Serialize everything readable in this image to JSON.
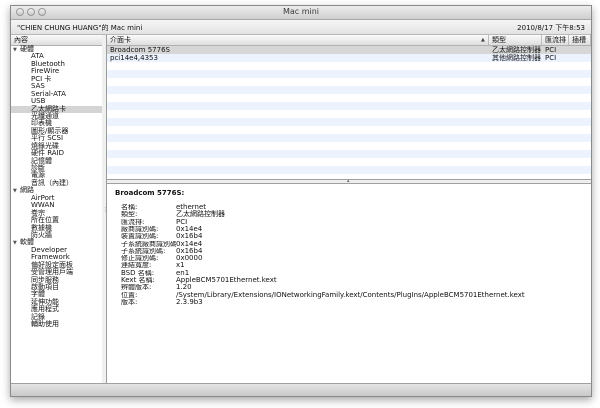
{
  "window": {
    "title": "Mac mini",
    "machine_name": "\"CHIEN CHUNG HUANG\"的 Mac mini",
    "datetime": "2010/8/17 下午8:53"
  },
  "sidebar": {
    "header": "內容",
    "categories": [
      {
        "label": "硬體",
        "items": [
          "ATA",
          "Bluetooth",
          "FireWire",
          "PCI 卡",
          "SAS",
          "Serial-ATA",
          "USB",
          "乙太網路卡",
          "光纖通道",
          "印表機",
          "圖形/顯示器",
          "平行 SCSI",
          "燒錄光碟",
          "硬件 RAID",
          "記憶體",
          "診斷",
          "電源",
          "音訊（內建）"
        ]
      },
      {
        "label": "網路",
        "items": [
          "AirPort",
          "WWAN",
          "卷宗",
          "所在位置",
          "數據機",
          "防火牆"
        ]
      },
      {
        "label": "軟體",
        "items": [
          "Developer",
          "Framework",
          "偏好設定面板",
          "受管理用戶端",
          "同步服務",
          "啟動項目",
          "字體",
          "延伸功能",
          "應用程式",
          "記錄",
          "輔助使用"
        ]
      }
    ],
    "selected": "乙太網路卡"
  },
  "table": {
    "columns": [
      "介面卡",
      "類型",
      "匯流排",
      "插槽"
    ],
    "rows": [
      {
        "name": "Broadcom 5776S",
        "type": "乙太網路控制器",
        "bus": "PCI",
        "slot": ""
      },
      {
        "name": "pci14e4,4353",
        "type": "其他網路控制器",
        "bus": "PCI",
        "slot": ""
      }
    ]
  },
  "detail": {
    "title": "Broadcom 5776S:",
    "fields": [
      {
        "key": "名稱:",
        "value": "ethernet"
      },
      {
        "key": "類型:",
        "value": "乙太網路控制器"
      },
      {
        "key": "匯流排:",
        "value": "PCI"
      },
      {
        "key": "廠商識別碼:",
        "value": "0x14e4"
      },
      {
        "key": "裝置識別碼:",
        "value": "0x16b4"
      },
      {
        "key": "子系統廠商識別碼:",
        "value": "0x14e4"
      },
      {
        "key": "子系統識別碼:",
        "value": "0x16b4"
      },
      {
        "key": "修正識別碼:",
        "value": "0x0000"
      },
      {
        "key": "連結寬度:",
        "value": "x1"
      },
      {
        "key": "BSD 名稱:",
        "value": "en1"
      },
      {
        "key": "Kext 名稱:",
        "value": "AppleBCM5701Ethernet.kext"
      },
      {
        "key": "辨體版本:",
        "value": "1.20"
      },
      {
        "key": "位置:",
        "value": "/System/Library/Extensions/IONetworkingFamily.kext/Contents/PlugIns/AppleBCM5701Ethernet.kext"
      },
      {
        "key": "版本:",
        "value": "2.3.9b3"
      }
    ]
  }
}
